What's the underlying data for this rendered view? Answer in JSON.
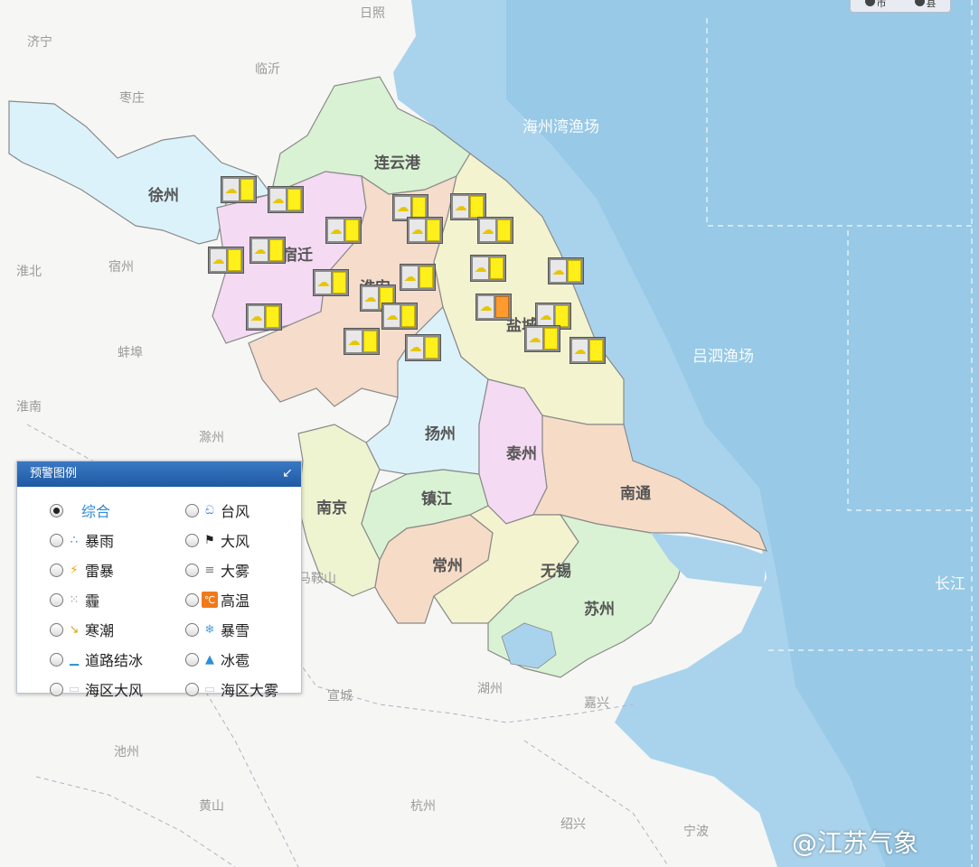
{
  "map": {
    "colors": {
      "sea": "#9fcde9",
      "sea_light": "#b9dcef",
      "land": "#f6f6f4",
      "xuzhou": "#dbf2fb",
      "lianyungang": "#d9f2d3",
      "suqian": "#f4daf2",
      "huaian": "#f5dccb",
      "yancheng": "#f3f3cf",
      "yangzhou": "#dbf2fb",
      "taizhou": "#f4daf2",
      "nantong": "#f6dcc6",
      "nanjing": "#eef3d0",
      "zhenjiang": "#d9f2d3",
      "changzhou": "#f6dcc6",
      "wuxi": "#f3f3cf",
      "suzhou": "#d9f2d3"
    },
    "place_labels": [
      "日照",
      "济宁",
      "临沂",
      "枣庄",
      "淮北",
      "宿州",
      "蚌埠",
      "淮南",
      "滁州",
      "马鞍山",
      "宣城",
      "湖州",
      "嘉兴",
      "池州",
      "黄山",
      "杭州",
      "绍兴",
      "宁波"
    ],
    "city_labels": [
      "徐州",
      "连云港",
      "宿迁",
      "淮安",
      "盐城",
      "扬州",
      "泰州",
      "南通",
      "南京",
      "镇江",
      "常州",
      "无锡",
      "苏州"
    ],
    "sea_labels": [
      "海州湾渔场",
      "吕泗渔场",
      "长江"
    ]
  },
  "toggles": {
    "city": "市",
    "county": "县"
  },
  "warnings": [
    {
      "type": "暴雨",
      "level": "yellow"
    },
    {
      "type": "暴雨",
      "level": "yellow"
    },
    {
      "type": "暴雨",
      "level": "yellow"
    },
    {
      "type": "暴雨",
      "level": "yellow"
    },
    {
      "type": "暴雨",
      "level": "yellow"
    },
    {
      "type": "暴雨",
      "level": "yellow"
    },
    {
      "type": "暴雨",
      "level": "yellow"
    },
    {
      "type": "暴雨",
      "level": "yellow"
    },
    {
      "type": "暴雨",
      "level": "yellow"
    },
    {
      "type": "暴雨",
      "level": "yellow"
    },
    {
      "type": "暴雨",
      "level": "yellow"
    },
    {
      "type": "暴雨",
      "level": "yellow"
    },
    {
      "type": "暴雨",
      "level": "yellow"
    },
    {
      "type": "暴雨",
      "level": "yellow"
    },
    {
      "type": "暴雨",
      "level": "yellow"
    },
    {
      "type": "暴雨",
      "level": "orange"
    },
    {
      "type": "暴雨",
      "level": "yellow"
    },
    {
      "type": "暴雨",
      "level": "yellow"
    },
    {
      "type": "暴雨",
      "level": "yellow"
    },
    {
      "type": "暴雨",
      "level": "yellow"
    },
    {
      "type": "暴雨",
      "level": "yellow"
    },
    {
      "type": "暴雨",
      "level": "yellow"
    }
  ],
  "legend": {
    "title": "预警图例",
    "items": [
      {
        "label": "综合",
        "icon": "composite-icon",
        "selected": true
      },
      {
        "label": "台风",
        "icon": "typhoon-icon",
        "selected": false
      },
      {
        "label": "暴雨",
        "icon": "rainstorm-icon",
        "selected": false
      },
      {
        "label": "大风",
        "icon": "gale-icon",
        "selected": false
      },
      {
        "label": "雷暴",
        "icon": "thunderstorm-icon",
        "selected": false
      },
      {
        "label": "大雾",
        "icon": "fog-icon",
        "selected": false
      },
      {
        "label": "霾",
        "icon": "haze-icon",
        "selected": false
      },
      {
        "label": "高温",
        "icon": "high-temperature-icon",
        "selected": false
      },
      {
        "label": "寒潮",
        "icon": "cold-wave-icon",
        "selected": false
      },
      {
        "label": "暴雪",
        "icon": "blizzard-icon",
        "selected": false
      },
      {
        "label": "道路结冰",
        "icon": "road-icing-icon",
        "selected": false
      },
      {
        "label": "冰雹",
        "icon": "hail-icon",
        "selected": false
      },
      {
        "label": "海区大风",
        "icon": "sea-gale-icon",
        "selected": false
      },
      {
        "label": "海区大雾",
        "icon": "sea-fog-icon",
        "selected": false
      }
    ]
  },
  "watermark": "@江苏气象"
}
